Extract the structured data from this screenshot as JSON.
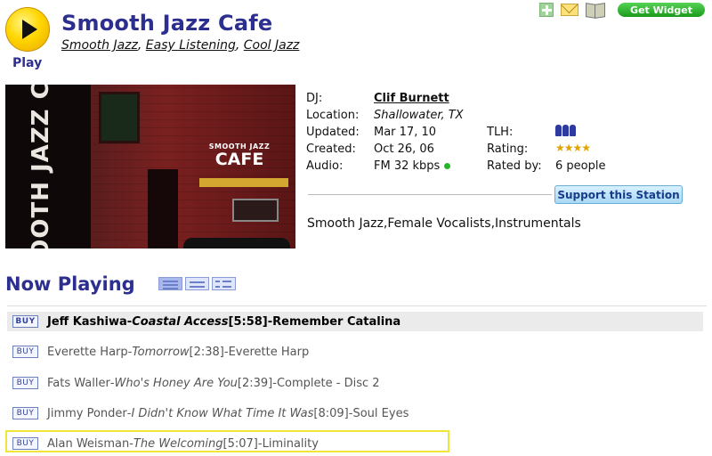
{
  "header": {
    "play_label": "Play",
    "station_name": "Smooth Jazz Cafe",
    "genres": [
      "Smooth Jazz",
      "Easy Listening",
      "Cool Jazz"
    ],
    "get_widget_label": "Get Widget",
    "icons": [
      "add-icon",
      "mail-icon",
      "book-icon"
    ]
  },
  "image": {
    "vertical_text": "SMOOTH JAZZ CAFE",
    "sign_small": "SMOOTH JAZZ",
    "sign_big": "CAFE"
  },
  "info": {
    "dj_label": "DJ:",
    "dj_value": "Clif Burnett",
    "location_label": "Location:",
    "location_value": "Shallowater, TX",
    "updated_label": "Updated:",
    "updated_value": "Mar 17, 10",
    "created_label": "Created:",
    "created_value": "Oct 26, 06",
    "audio_label": "Audio:",
    "audio_value": "FM 32 kbps",
    "tlh_label": "TLH:",
    "rating_label": "Rating:",
    "rating_value": 4,
    "rated_by_label": "Rated by:",
    "rated_by_value": "6 people",
    "support_label": "Support this Station",
    "tags": "Smooth Jazz,Female Vocalists,Instrumentals"
  },
  "now_playing": {
    "heading": "Now Playing",
    "buy_label": "BUY",
    "tracks": [
      {
        "artist": "Jeff Kashiwa",
        "title": "Coastal Access",
        "duration": "[5:58]",
        "album": "Remember Catalina"
      },
      {
        "artist": "Everette Harp",
        "title": "Tomorrow",
        "duration": "[2:38]",
        "album": "Everette Harp"
      },
      {
        "artist": "Fats Waller",
        "title": "Who's Honey Are You",
        "duration": "[2:39]",
        "album": "Complete - Disc 2"
      },
      {
        "artist": "Jimmy Ponder",
        "title": "I Didn't Know What Time It Was",
        "duration": "[8:09]",
        "album": "Soul Eyes"
      },
      {
        "artist": "Alan Weisman",
        "title": "The Welcoming",
        "duration": "[5:07]",
        "album": "Liminality"
      }
    ],
    "sep": " - ",
    "space": " "
  },
  "colors": {
    "title_blue": "#2d2f8f",
    "play_yellow": "#ffd600",
    "status_green": "#26b526"
  }
}
